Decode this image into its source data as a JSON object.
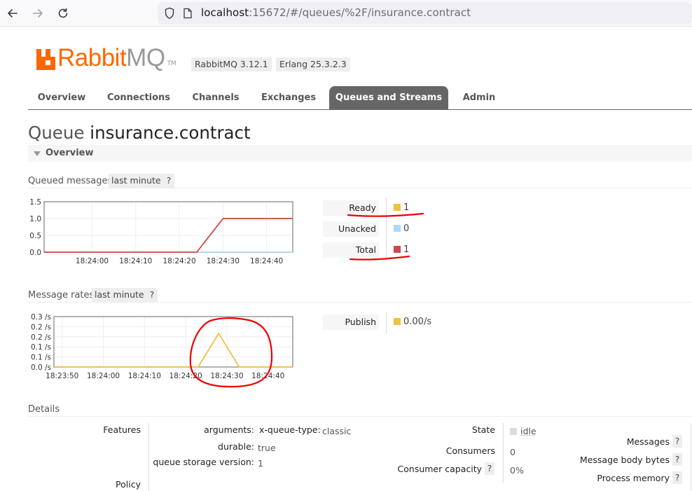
{
  "browser": {
    "url_host": "localhost",
    "url_rest": ":15672/#/queues/%2F/insurance.contract"
  },
  "header": {
    "logo_primary": "Rabbit",
    "logo_secondary": "MQ",
    "logo_tm": "TM",
    "rabbitmq_version": "RabbitMQ 3.12.1",
    "erlang_version": "Erlang 25.3.2.3",
    "brand_color": "#ff6600"
  },
  "tabs": [
    {
      "label": "Overview",
      "active": false
    },
    {
      "label": "Connections",
      "active": false
    },
    {
      "label": "Channels",
      "active": false
    },
    {
      "label": "Exchanges",
      "active": false
    },
    {
      "label": "Queues and Streams",
      "active": true
    },
    {
      "label": "Admin",
      "active": false
    }
  ],
  "page": {
    "title_prefix": "Queue",
    "queue_name": "insurance.contract",
    "section_title": "Overview"
  },
  "queued_messages": {
    "title": "Queued messages",
    "range": "last minute",
    "help": "?",
    "chart_data": {
      "type": "line",
      "x": [
        "18:24:00",
        "18:24:10",
        "18:24:20",
        "18:24:30",
        "18:24:40"
      ],
      "y_ticks": [
        "1.5",
        "1.0",
        "0.5",
        "0.0"
      ],
      "ylim": [
        0,
        1.5
      ],
      "x_range_seconds": [
        -11,
        46
      ],
      "series": [
        {
          "name": "Ready",
          "color": "#edc240",
          "points": [
            [
              -11,
              0
            ],
            [
              24,
              0
            ],
            [
              30,
              1
            ],
            [
              46,
              1
            ]
          ]
        },
        {
          "name": "Unacked",
          "color": "#afd8f8",
          "points": [
            [
              -11,
              0
            ],
            [
              24,
              0
            ],
            [
              30,
              0
            ],
            [
              46,
              0
            ]
          ]
        },
        {
          "name": "Total",
          "color": "#cb4b4b",
          "points": [
            [
              -11,
              0
            ],
            [
              24,
              0
            ],
            [
              30,
              1
            ],
            [
              46,
              1
            ]
          ]
        }
      ]
    },
    "legend": [
      {
        "label": "Ready",
        "value": "1",
        "color": "#edc240"
      },
      {
        "label": "Unacked",
        "value": "0",
        "color": "#afd8f8"
      },
      {
        "label": "Total",
        "value": "1",
        "color": "#cb4b4b"
      }
    ]
  },
  "message_rates": {
    "title": "Message rates",
    "range": "last minute",
    "help": "?",
    "chart_data": {
      "type": "line",
      "x": [
        "18:23:50",
        "18:24:00",
        "18:24:10",
        "18:24:20",
        "18:24:30",
        "18:24:40"
      ],
      "y_ticks": [
        "0.3 /s",
        "0.2 /s",
        "0.2 /s",
        "0.1 /s",
        "0.1 /s",
        "0.0 /s"
      ],
      "ylim": [
        0,
        0.3
      ],
      "x_range_seconds": [
        -12,
        46
      ],
      "series": [
        {
          "name": "Publish",
          "color": "#edc240",
          "points": [
            [
              -12,
              0
            ],
            [
              23,
              0
            ],
            [
              28,
              0.2
            ],
            [
              33,
              0
            ],
            [
              46,
              0
            ]
          ]
        }
      ]
    },
    "legend": [
      {
        "label": "Publish",
        "value": "0.00/s",
        "color": "#edc240"
      }
    ]
  },
  "details": {
    "title": "Details",
    "features_label": "Features",
    "policy_label": "Policy",
    "arguments_label": "arguments:",
    "argument_key": "x-queue-type:",
    "argument_value": "classic",
    "durable_label": "durable:",
    "durable_value": "true",
    "storage_label": "queue storage version:",
    "storage_value": "1",
    "state_label": "State",
    "state_value": "idle",
    "consumers_label": "Consumers",
    "consumers_value": "0",
    "consumer_capacity_label": "Consumer capacity",
    "consumer_capacity_value": "0%",
    "messages_label": "Messages",
    "body_bytes_label": "Message body bytes",
    "process_memory_label": "Process memory",
    "help": "?"
  }
}
